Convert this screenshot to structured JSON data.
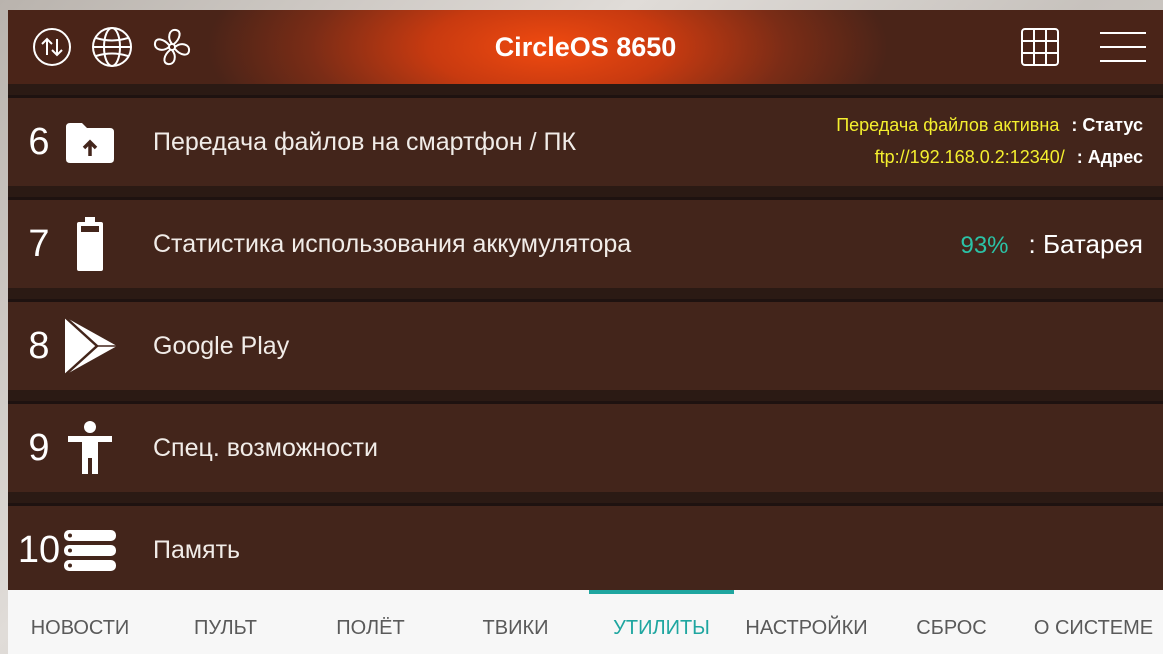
{
  "header": {
    "title": "CircleOS 8650",
    "icons_left": [
      "transfer-arrows-icon",
      "globe-icon",
      "fan-icon"
    ],
    "icons_right": [
      "grid-icon",
      "menu-icon"
    ]
  },
  "rows": [
    {
      "number": "6",
      "icon": "upload-folder-icon",
      "label": "Передача файлов на смартфон / ПК",
      "info": [
        {
          "value": "Передача файлов активна",
          "label": ": Статус"
        },
        {
          "value": "ftp://192.168.0.2:12340/",
          "label": ": Адрес"
        }
      ]
    },
    {
      "number": "7",
      "icon": "battery-icon",
      "label": "Статистика использования аккумулятора",
      "info": [
        {
          "value": "93%",
          "label": ": Батарея"
        }
      ]
    },
    {
      "number": "8",
      "icon": "play-store-icon",
      "label": "Google Play"
    },
    {
      "number": "9",
      "icon": "accessibility-icon",
      "label": "Спец. возможности"
    },
    {
      "number": "10",
      "icon": "storage-icon",
      "label": "Память"
    }
  ],
  "tabs": [
    {
      "label": "НОВОСТИ"
    },
    {
      "label": "ПУЛЬТ"
    },
    {
      "label": "ПОЛЁТ"
    },
    {
      "label": "ТВИКИ"
    },
    {
      "label": "УТИЛИТЫ",
      "active": true
    },
    {
      "label": "НАСТРОЙКИ"
    },
    {
      "label": "СБРОС"
    },
    {
      "label": "О СИСТЕМЕ"
    }
  ],
  "colors": {
    "accent": "#1fa6a0",
    "status_yellow": "#f4ef2e",
    "battery_teal": "#2bc2a6",
    "row_background": "#43251b",
    "header_orange": "#f04a10"
  }
}
